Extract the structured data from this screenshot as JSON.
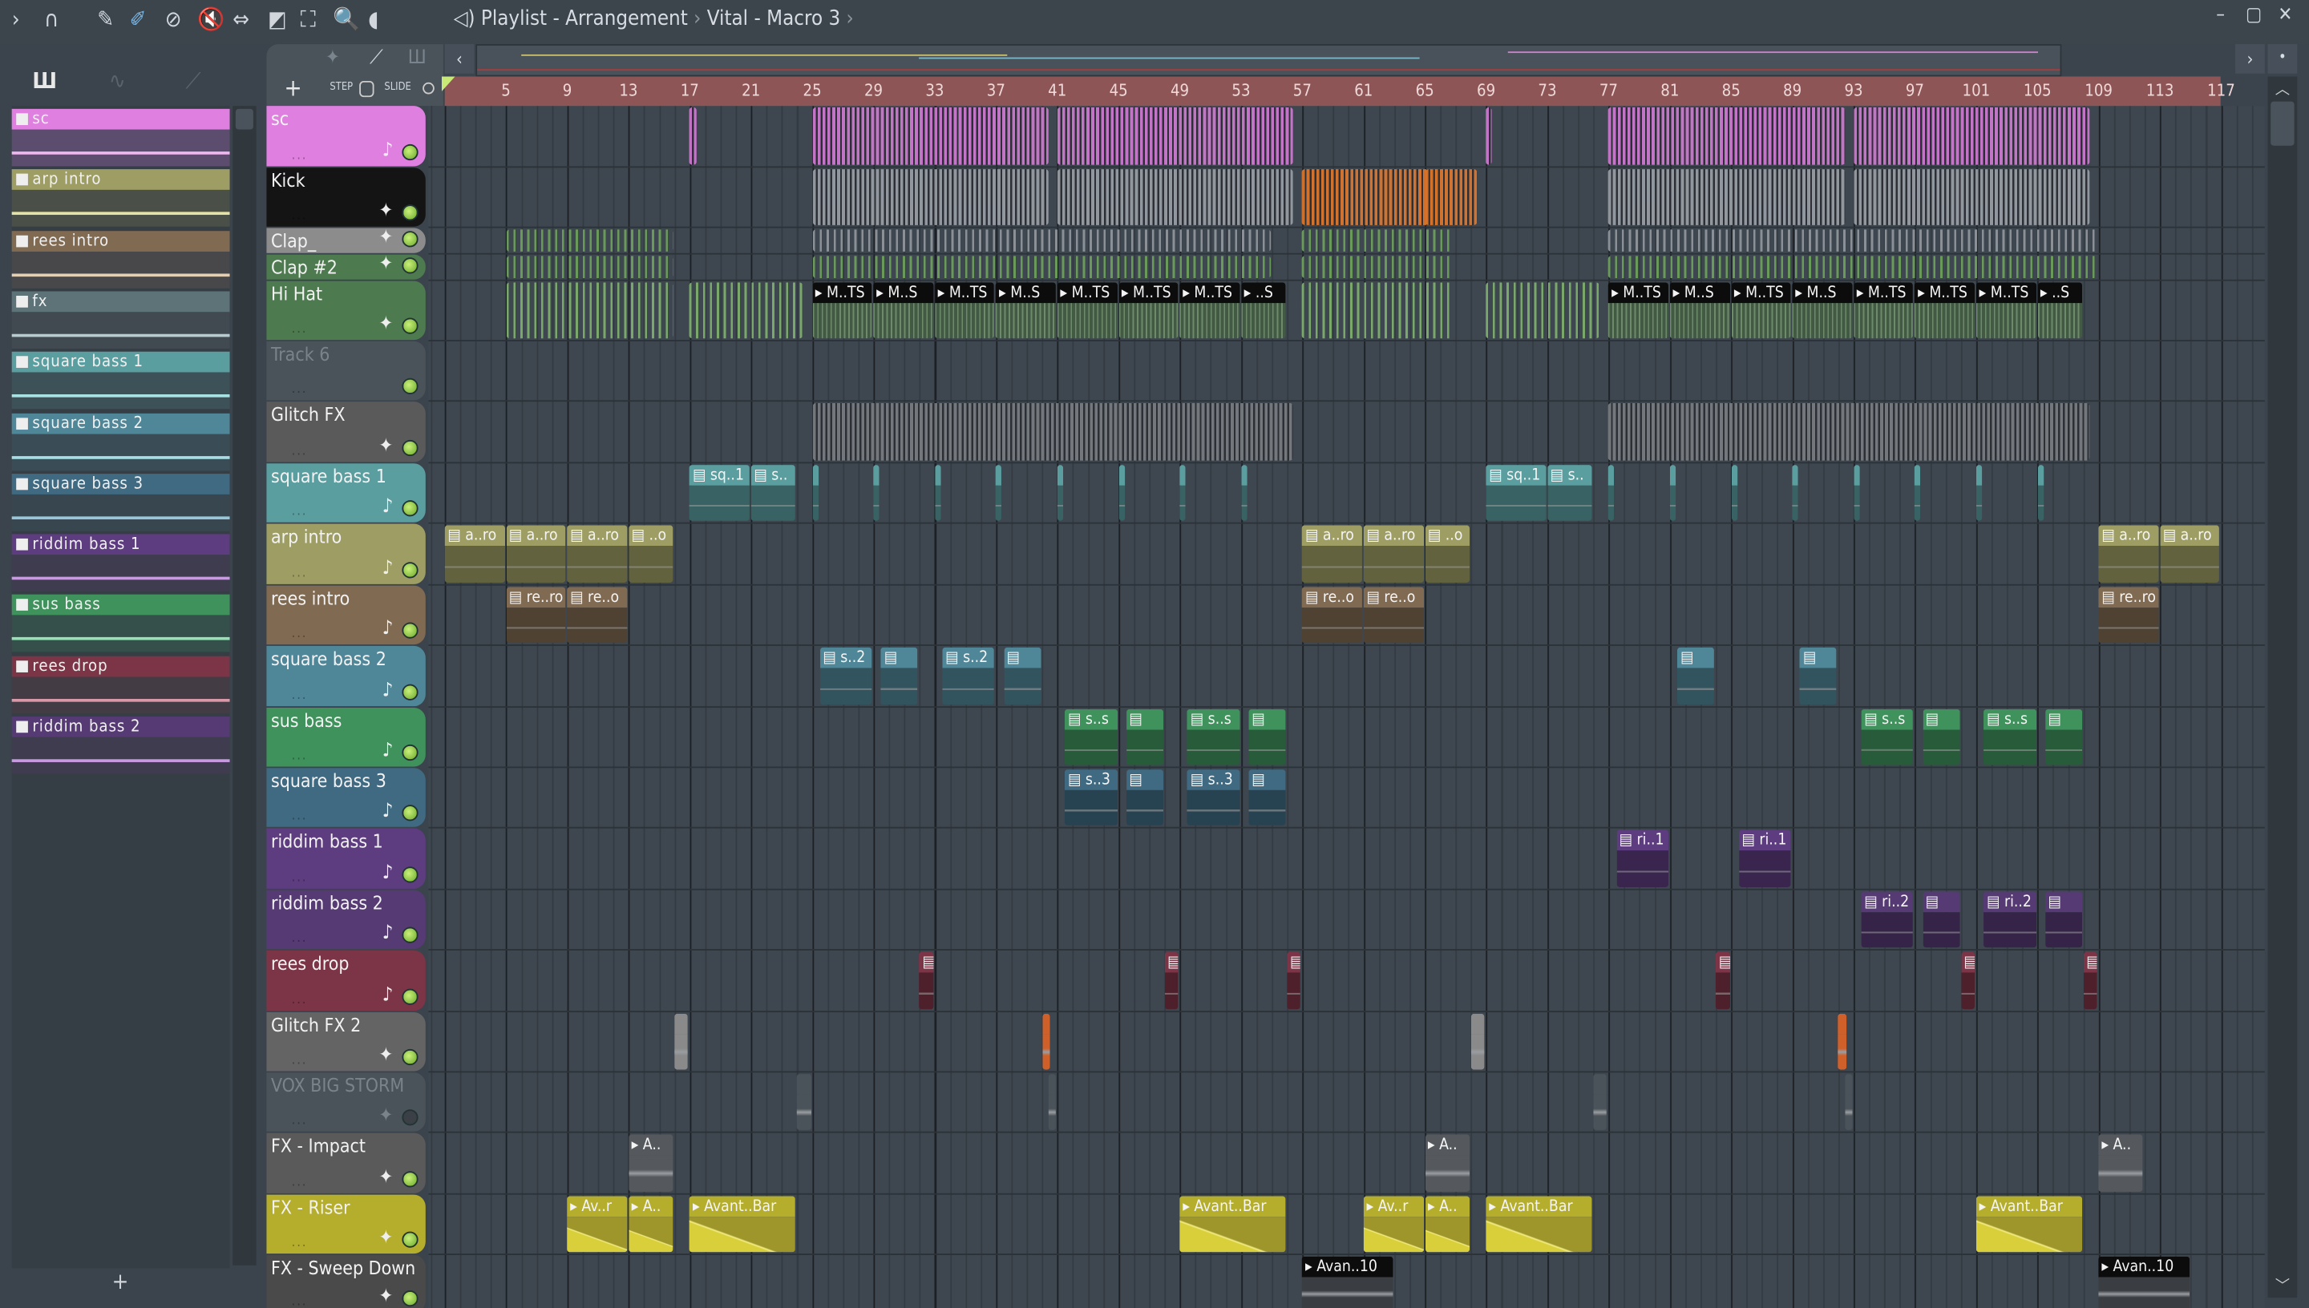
{
  "toolbar": {
    "icons": [
      "arrow-right-icon",
      "magnet-icon",
      "pencil-icon",
      "paint-icon",
      "delete-icon",
      "mute-icon",
      "slip-icon",
      "slice-icon",
      "select-icon",
      "zoom-icon",
      "playback-icon"
    ],
    "glyphs": [
      "›",
      "∩",
      "✎",
      "✐",
      "⊘",
      "🔇",
      "⇔",
      "◩",
      "⛶",
      "🔍",
      "◖"
    ]
  },
  "title": {
    "speaker": "◁)",
    "text": "Playlist - Arrangement",
    "sep": "›",
    "sub": "Vital - Macro 3",
    "sep2": "›"
  },
  "window": {
    "minimize": "–",
    "maximize": "▢",
    "close": "✕"
  },
  "picker": {
    "tabs": [
      "Ш",
      "∿",
      "⟋"
    ],
    "add": "+",
    "items": [
      {
        "label": "sc",
        "color": "#df7fe0",
        "body": "#5c4c6e",
        "line": "#f0b6f0"
      },
      {
        "label": "arp intro",
        "color": "#9e9e64",
        "body": "#4a5048",
        "line": "#e4e2a4"
      },
      {
        "label": "rees intro",
        "color": "#806a52",
        "body": "#48484a",
        "line": "#e2cfb4"
      },
      {
        "label": "fx",
        "color": "#5e7378",
        "body": "#404a50",
        "line": "#b7cbd0"
      },
      {
        "label": "square bass 1",
        "color": "#5a9ea0",
        "body": "#3d5258",
        "line": "#a8e2e2"
      },
      {
        "label": "square bass 2",
        "color": "#4f8799",
        "body": "#3a4c56",
        "line": "#a8dce6"
      },
      {
        "label": "square bass 3",
        "color": "#3f6a82",
        "body": "#38464f",
        "line": "#98c6d8"
      },
      {
        "label": "riddim bass 1",
        "color": "#5e3c80",
        "body": "#3e3c4e",
        "line": "#c89ae0"
      },
      {
        "label": "sus bass",
        "color": "#3f925c",
        "body": "#35504a",
        "line": "#98e0b6"
      },
      {
        "label": "rees drop",
        "color": "#7c3447",
        "body": "#443c44",
        "line": "#d899a8"
      },
      {
        "label": "riddim bass 2",
        "color": "#553a74",
        "body": "#3e3c4e",
        "line": "#c89ae0"
      }
    ]
  },
  "step": {
    "step_label": "STEP",
    "slide_label": "SLIDE",
    "add": "+"
  },
  "ruler": {
    "labels": [
      "5",
      "9",
      "13",
      "17",
      "21",
      "25",
      "29",
      "33",
      "37",
      "41",
      "45",
      "49",
      "53",
      "57",
      "61",
      "65",
      "69",
      "73",
      "77",
      "81",
      "85",
      "89",
      "93",
      "97",
      "101",
      "105",
      "109",
      "113",
      "117"
    ]
  },
  "tracks": [
    {
      "name": "sc",
      "color": "#df7fe0",
      "icon": "♪",
      "led": true
    },
    {
      "name": "Kick",
      "color": "#141414",
      "icon": "✦",
      "led": true
    },
    {
      "name": "Clap_",
      "color": "#8c8c8c",
      "icon": "✦",
      "led": true
    },
    {
      "name": "Clap  #2",
      "color": "#4d7a4e",
      "icon": "✦",
      "led": true
    },
    {
      "name": "Hi Hat",
      "color": "#4d7a4e",
      "icon": "✦",
      "led": true
    },
    {
      "name": "Track 6",
      "color": "#4b535a",
      "icon": "",
      "led": true,
      "dim": true
    },
    {
      "name": "Glitch FX",
      "color": "#5a5a5a",
      "icon": "✦",
      "led": true
    },
    {
      "name": "square bass 1",
      "color": "#5a9ea0",
      "icon": "♪",
      "led": true
    },
    {
      "name": "arp intro",
      "color": "#9e9e64",
      "icon": "♪",
      "led": true
    },
    {
      "name": "rees intro",
      "color": "#806a52",
      "icon": "♪",
      "led": true
    },
    {
      "name": "square bass 2",
      "color": "#4f8799",
      "icon": "♪",
      "led": true
    },
    {
      "name": "sus bass",
      "color": "#3f925c",
      "icon": "♪",
      "led": true
    },
    {
      "name": "square bass 3",
      "color": "#3f6a82",
      "icon": "♪",
      "led": true
    },
    {
      "name": "riddim bass 1",
      "color": "#5e3c80",
      "icon": "♪",
      "led": true
    },
    {
      "name": "riddim bass 2",
      "color": "#553a74",
      "icon": "♪",
      "led": true
    },
    {
      "name": "rees drop",
      "color": "#7c3447",
      "icon": "♪",
      "led": true
    },
    {
      "name": "Glitch FX 2",
      "color": "#646464",
      "icon": "✦",
      "led": true
    },
    {
      "name": "VOX BIG STORM",
      "color": "#4b535a",
      "icon": "✦",
      "led": false,
      "dim": true
    },
    {
      "name": "FX - Impact",
      "color": "#5a5a5a",
      "icon": "✦",
      "led": true
    },
    {
      "name": "FX - Riser",
      "color": "#b5ad2c",
      "icon": "✦",
      "led": true
    },
    {
      "name": "FX - Sweep Down",
      "color": "#4a4a4a",
      "icon": "✦",
      "led": true
    }
  ],
  "clips": [
    {
      "t": 0,
      "s": 17,
      "l": 0.5,
      "k": "dense",
      "c": "#d17ad3"
    },
    {
      "t": 0,
      "s": 25,
      "l": 15.5,
      "k": "dense",
      "c": "#d17ad3"
    },
    {
      "t": 0,
      "s": 41,
      "l": 15.5,
      "k": "dense",
      "c": "#d17ad3"
    },
    {
      "t": 0,
      "s": 69,
      "l": 0.5,
      "k": "dense",
      "c": "#d17ad3"
    },
    {
      "t": 0,
      "s": 77,
      "l": 15.5,
      "k": "dense",
      "c": "#d17ad3"
    },
    {
      "t": 0,
      "s": 93,
      "l": 15.5,
      "k": "dense",
      "c": "#d17ad3"
    },
    {
      "t": 1,
      "s": 25,
      "l": 15.5,
      "k": "dense",
      "c": "#9aa0a6"
    },
    {
      "t": 1,
      "s": 41,
      "l": 15.5,
      "k": "dense",
      "c": "#9aa0a6"
    },
    {
      "t": 1,
      "s": 57,
      "l": 9,
      "k": "dense",
      "c": "#e0782c"
    },
    {
      "t": 1,
      "s": 65,
      "l": 3.5,
      "k": "dense",
      "c": "#e0782c"
    },
    {
      "t": 1,
      "s": 77,
      "l": 15.5,
      "k": "dense",
      "c": "#9aa0a6"
    },
    {
      "t": 1,
      "s": 93,
      "l": 15.5,
      "k": "dense",
      "c": "#9aa0a6"
    },
    {
      "t": 2,
      "s": 5,
      "l": 11,
      "k": "ticks",
      "c": "#6a9a5a"
    },
    {
      "t": 2,
      "s": 25,
      "l": 30,
      "k": "ticks",
      "c": "#8a9096"
    },
    {
      "t": 2,
      "s": 57,
      "l": 10,
      "k": "ticks",
      "c": "#6a9a5a"
    },
    {
      "t": 2,
      "s": 77,
      "l": 32,
      "k": "ticks",
      "c": "#8a9096"
    },
    {
      "t": 3,
      "s": 5,
      "l": 11,
      "k": "ticks",
      "c": "#6a9a5a"
    },
    {
      "t": 3,
      "s": 25,
      "l": 30,
      "k": "ticks",
      "c": "#6a9a5a"
    },
    {
      "t": 3,
      "s": 57,
      "l": 10,
      "k": "ticks",
      "c": "#6a9a5a"
    },
    {
      "t": 3,
      "s": 77,
      "l": 32,
      "k": "ticks",
      "c": "#6a9a5a"
    },
    {
      "t": 4,
      "s": 5,
      "l": 11,
      "k": "ticks",
      "c": "#7aa86a"
    },
    {
      "t": 4,
      "s": 17,
      "l": 7.5,
      "k": "ticks",
      "c": "#7aa86a"
    },
    {
      "t": 4,
      "s": 25,
      "l": 4,
      "k": "audio",
      "label": "M..TS",
      "c": "#4d6a4e"
    },
    {
      "t": 4,
      "s": 29,
      "l": 4,
      "k": "audio",
      "label": "M..S",
      "c": "#4d6a4e"
    },
    {
      "t": 4,
      "s": 33,
      "l": 4,
      "k": "audio",
      "label": "M..TS",
      "c": "#4d6a4e"
    },
    {
      "t": 4,
      "s": 37,
      "l": 4,
      "k": "audio",
      "label": "M..S",
      "c": "#4d6a4e"
    },
    {
      "t": 4,
      "s": 41,
      "l": 4,
      "k": "audio",
      "label": "M..TS",
      "c": "#4d6a4e"
    },
    {
      "t": 4,
      "s": 45,
      "l": 4,
      "k": "audio",
      "label": "M..TS",
      "c": "#4d6a4e"
    },
    {
      "t": 4,
      "s": 49,
      "l": 4,
      "k": "audio",
      "label": "M..TS",
      "c": "#4d6a4e"
    },
    {
      "t": 4,
      "s": 53,
      "l": 3,
      "k": "audio",
      "label": "..S",
      "c": "#4d6a4e"
    },
    {
      "t": 4,
      "s": 57,
      "l": 10,
      "k": "ticks",
      "c": "#7aa86a"
    },
    {
      "t": 4,
      "s": 69,
      "l": 7.5,
      "k": "ticks",
      "c": "#7aa86a"
    },
    {
      "t": 4,
      "s": 77,
      "l": 4,
      "k": "audio",
      "label": "M..TS",
      "c": "#4d6a4e"
    },
    {
      "t": 4,
      "s": 81,
      "l": 4,
      "k": "audio",
      "label": "M..S",
      "c": "#4d6a4e"
    },
    {
      "t": 4,
      "s": 85,
      "l": 4,
      "k": "audio",
      "label": "M..TS",
      "c": "#4d6a4e"
    },
    {
      "t": 4,
      "s": 89,
      "l": 4,
      "k": "audio",
      "label": "M..S",
      "c": "#4d6a4e"
    },
    {
      "t": 4,
      "s": 93,
      "l": 4,
      "k": "audio",
      "label": "M..TS",
      "c": "#4d6a4e"
    },
    {
      "t": 4,
      "s": 97,
      "l": 4,
      "k": "audio",
      "label": "M..TS",
      "c": "#4d6a4e"
    },
    {
      "t": 4,
      "s": 101,
      "l": 4,
      "k": "audio",
      "label": "M..TS",
      "c": "#4d6a4e"
    },
    {
      "t": 4,
      "s": 105,
      "l": 3,
      "k": "audio",
      "label": "..S",
      "c": "#4d6a4e"
    },
    {
      "t": 6,
      "s": 25,
      "l": 31.5,
      "k": "dense",
      "c": "#7a7e82"
    },
    {
      "t": 6,
      "s": 77,
      "l": 31.5,
      "k": "dense",
      "c": "#7a7e82"
    },
    {
      "t": 7,
      "s": 17,
      "l": 4,
      "k": "pattern",
      "label": "sq..1",
      "c": "#5a9ea0"
    },
    {
      "t": 7,
      "s": 21,
      "l": 3,
      "k": "pattern",
      "label": "s..",
      "c": "#5a9ea0"
    },
    {
      "t": 7,
      "s": 25,
      "l": 0.4,
      "k": "pattern",
      "c": "#5a9ea0"
    },
    {
      "t": 7,
      "s": 29,
      "l": 0.4,
      "k": "pattern",
      "c": "#5a9ea0"
    },
    {
      "t": 7,
      "s": 33,
      "l": 0.4,
      "k": "pattern",
      "c": "#5a9ea0"
    },
    {
      "t": 7,
      "s": 37,
      "l": 0.4,
      "k": "pattern",
      "c": "#5a9ea0"
    },
    {
      "t": 7,
      "s": 41,
      "l": 0.4,
      "k": "pattern",
      "c": "#5a9ea0"
    },
    {
      "t": 7,
      "s": 45,
      "l": 0.4,
      "k": "pattern",
      "c": "#5a9ea0"
    },
    {
      "t": 7,
      "s": 49,
      "l": 0.4,
      "k": "pattern",
      "c": "#5a9ea0"
    },
    {
      "t": 7,
      "s": 53,
      "l": 0.4,
      "k": "pattern",
      "c": "#5a9ea0"
    },
    {
      "t": 7,
      "s": 69,
      "l": 4,
      "k": "pattern",
      "label": "sq..1",
      "c": "#5a9ea0"
    },
    {
      "t": 7,
      "s": 73,
      "l": 3,
      "k": "pattern",
      "label": "s..",
      "c": "#5a9ea0"
    },
    {
      "t": 7,
      "s": 77,
      "l": 0.4,
      "k": "pattern",
      "c": "#5a9ea0"
    },
    {
      "t": 7,
      "s": 81,
      "l": 0.4,
      "k": "pattern",
      "c": "#5a9ea0"
    },
    {
      "t": 7,
      "s": 85,
      "l": 0.4,
      "k": "pattern",
      "c": "#5a9ea0"
    },
    {
      "t": 7,
      "s": 89,
      "l": 0.4,
      "k": "pattern",
      "c": "#5a9ea0"
    },
    {
      "t": 7,
      "s": 93,
      "l": 0.4,
      "k": "pattern",
      "c": "#5a9ea0"
    },
    {
      "t": 7,
      "s": 97,
      "l": 0.4,
      "k": "pattern",
      "c": "#5a9ea0"
    },
    {
      "t": 7,
      "s": 101,
      "l": 0.4,
      "k": "pattern",
      "c": "#5a9ea0"
    },
    {
      "t": 7,
      "s": 105,
      "l": 0.4,
      "k": "pattern",
      "c": "#5a9ea0"
    },
    {
      "t": 8,
      "s": 1,
      "l": 4,
      "k": "pattern",
      "label": "a..ro",
      "c": "#9e9e64"
    },
    {
      "t": 8,
      "s": 5,
      "l": 4,
      "k": "pattern",
      "label": "a..ro",
      "c": "#9e9e64"
    },
    {
      "t": 8,
      "s": 9,
      "l": 4,
      "k": "pattern",
      "label": "a..ro",
      "c": "#9e9e64"
    },
    {
      "t": 8,
      "s": 13,
      "l": 3,
      "k": "pattern",
      "label": "..o",
      "c": "#9e9e64"
    },
    {
      "t": 8,
      "s": 57,
      "l": 4,
      "k": "pattern",
      "label": "a..ro",
      "c": "#9e9e64"
    },
    {
      "t": 8,
      "s": 61,
      "l": 4,
      "k": "pattern",
      "label": "a..ro",
      "c": "#9e9e64"
    },
    {
      "t": 8,
      "s": 65,
      "l": 3,
      "k": "pattern",
      "label": "..o",
      "c": "#9e9e64"
    },
    {
      "t": 8,
      "s": 109,
      "l": 4,
      "k": "pattern",
      "label": "a..ro",
      "c": "#9e9e64"
    },
    {
      "t": 8,
      "s": 113,
      "l": 4,
      "k": "pattern",
      "label": "a..ro",
      "c": "#9e9e64"
    },
    {
      "t": 9,
      "s": 5,
      "l": 4,
      "k": "pattern",
      "label": "re..ro",
      "c": "#806a52"
    },
    {
      "t": 9,
      "s": 9,
      "l": 4,
      "k": "pattern",
      "label": "re..o",
      "c": "#806a52"
    },
    {
      "t": 9,
      "s": 57,
      "l": 4,
      "k": "pattern",
      "label": "re..o",
      "c": "#806a52"
    },
    {
      "t": 9,
      "s": 61,
      "l": 4,
      "k": "pattern",
      "label": "re..o",
      "c": "#806a52"
    },
    {
      "t": 9,
      "s": 109,
      "l": 4,
      "k": "pattern",
      "label": "re..ro",
      "c": "#806a52"
    },
    {
      "t": 10,
      "s": 25.5,
      "l": 3.5,
      "k": "pattern",
      "label": "s..2",
      "c": "#4f8799"
    },
    {
      "t": 10,
      "s": 29.5,
      "l": 2.5,
      "k": "pattern",
      "label": "",
      "c": "#4f8799"
    },
    {
      "t": 10,
      "s": 33.5,
      "l": 3.5,
      "k": "pattern",
      "label": "s..2",
      "c": "#4f8799"
    },
    {
      "t": 10,
      "s": 37.5,
      "l": 2.5,
      "k": "pattern",
      "label": "",
      "c": "#4f8799"
    },
    {
      "t": 10,
      "s": 81.5,
      "l": 2.5,
      "k": "pattern",
      "label": "",
      "c": "#4f8799"
    },
    {
      "t": 10,
      "s": 89.5,
      "l": 2.5,
      "k": "pattern",
      "label": "",
      "c": "#4f8799"
    },
    {
      "t": 11,
      "s": 41.5,
      "l": 3.5,
      "k": "pattern",
      "label": "s..s",
      "c": "#3f925c"
    },
    {
      "t": 11,
      "s": 45.5,
      "l": 2.5,
      "k": "pattern",
      "label": "",
      "c": "#3f925c"
    },
    {
      "t": 11,
      "s": 49.5,
      "l": 3.5,
      "k": "pattern",
      "label": "s..s",
      "c": "#3f925c"
    },
    {
      "t": 11,
      "s": 53.5,
      "l": 2.5,
      "k": "pattern",
      "label": "",
      "c": "#3f925c"
    },
    {
      "t": 11,
      "s": 93.5,
      "l": 3.5,
      "k": "pattern",
      "label": "s..s",
      "c": "#3f925c"
    },
    {
      "t": 11,
      "s": 97.5,
      "l": 2.5,
      "k": "pattern",
      "label": "",
      "c": "#3f925c"
    },
    {
      "t": 11,
      "s": 101.5,
      "l": 3.5,
      "k": "pattern",
      "label": "s..s",
      "c": "#3f925c"
    },
    {
      "t": 11,
      "s": 105.5,
      "l": 2.5,
      "k": "pattern",
      "label": "",
      "c": "#3f925c"
    },
    {
      "t": 12,
      "s": 41.5,
      "l": 3.5,
      "k": "pattern",
      "label": "s..3",
      "c": "#3f6a82"
    },
    {
      "t": 12,
      "s": 45.5,
      "l": 2.5,
      "k": "pattern",
      "label": "",
      "c": "#3f6a82"
    },
    {
      "t": 12,
      "s": 49.5,
      "l": 3.5,
      "k": "pattern",
      "label": "s..3",
      "c": "#3f6a82"
    },
    {
      "t": 12,
      "s": 53.5,
      "l": 2.5,
      "k": "pattern",
      "label": "",
      "c": "#3f6a82"
    },
    {
      "t": 13,
      "s": 77.5,
      "l": 3.5,
      "k": "pattern",
      "label": "ri..1",
      "c": "#5e3c80"
    },
    {
      "t": 13,
      "s": 85.5,
      "l": 3.5,
      "k": "pattern",
      "label": "ri..1",
      "c": "#5e3c80"
    },
    {
      "t": 14,
      "s": 93.5,
      "l": 3.5,
      "k": "pattern",
      "label": "ri..2",
      "c": "#553a74"
    },
    {
      "t": 14,
      "s": 97.5,
      "l": 2.5,
      "k": "pattern",
      "label": "",
      "c": "#553a74"
    },
    {
      "t": 14,
      "s": 101.5,
      "l": 3.5,
      "k": "pattern",
      "label": "ri..2",
      "c": "#553a74"
    },
    {
      "t": 14,
      "s": 105.5,
      "l": 2.5,
      "k": "pattern",
      "label": "",
      "c": "#553a74"
    },
    {
      "t": 15,
      "s": 32,
      "l": 1,
      "k": "pattern",
      "c": "#7c3447"
    },
    {
      "t": 15,
      "s": 48,
      "l": 1,
      "k": "pattern",
      "c": "#7c3447"
    },
    {
      "t": 15,
      "s": 56,
      "l": 1,
      "k": "pattern",
      "c": "#7c3447"
    },
    {
      "t": 15,
      "s": 84,
      "l": 1,
      "k": "pattern",
      "c": "#7c3447"
    },
    {
      "t": 15,
      "s": 100,
      "l": 1,
      "k": "pattern",
      "c": "#7c3447"
    },
    {
      "t": 15,
      "s": 108,
      "l": 1,
      "k": "pattern",
      "c": "#7c3447"
    },
    {
      "t": 16,
      "s": 16,
      "l": 1,
      "k": "audio",
      "c": "#8a8a8a"
    },
    {
      "t": 16,
      "s": 40,
      "l": 0.6,
      "k": "audio",
      "c": "#d0602a"
    },
    {
      "t": 16,
      "s": 68,
      "l": 1,
      "k": "audio",
      "c": "#8a8a8a"
    },
    {
      "t": 16,
      "s": 92,
      "l": 0.6,
      "k": "audio",
      "c": "#d0602a"
    },
    {
      "t": 17,
      "s": 24,
      "l": 1,
      "k": "audio",
      "c": "#4b535a"
    },
    {
      "t": 17,
      "s": 40.4,
      "l": 0.6,
      "k": "audio",
      "c": "#4b535a"
    },
    {
      "t": 17,
      "s": 76,
      "l": 1,
      "k": "audio",
      "c": "#4b535a"
    },
    {
      "t": 17,
      "s": 92.4,
      "l": 0.6,
      "k": "audio",
      "c": "#4b535a"
    },
    {
      "t": 18,
      "s": 13,
      "l": 3,
      "k": "audio",
      "label": "A..",
      "c": "#55595d"
    },
    {
      "t": 18,
      "s": 65,
      "l": 3,
      "k": "audio",
      "label": "A..",
      "c": "#55595d"
    },
    {
      "t": 18,
      "s": 109,
      "l": 3,
      "k": "audio",
      "label": "A..",
      "c": "#55595d"
    },
    {
      "t": 19,
      "s": 9,
      "l": 4,
      "k": "audio",
      "label": "Av..r",
      "c": "#b5ad2c"
    },
    {
      "t": 19,
      "s": 13,
      "l": 3,
      "k": "audio",
      "label": "A..",
      "c": "#b5ad2c"
    },
    {
      "t": 19,
      "s": 17,
      "l": 7,
      "k": "audio",
      "label": "Avant..Bar",
      "c": "#b5ad2c"
    },
    {
      "t": 19,
      "s": 49,
      "l": 7,
      "k": "audio",
      "label": "Avant..Bar",
      "c": "#b5ad2c"
    },
    {
      "t": 19,
      "s": 61,
      "l": 4,
      "k": "audio",
      "label": "Av..r",
      "c": "#b5ad2c"
    },
    {
      "t": 19,
      "s": 65,
      "l": 3,
      "k": "audio",
      "label": "A..",
      "c": "#b5ad2c"
    },
    {
      "t": 19,
      "s": 69,
      "l": 7,
      "k": "audio",
      "label": "Avant..Bar",
      "c": "#b5ad2c"
    },
    {
      "t": 19,
      "s": 101,
      "l": 7,
      "k": "audio",
      "label": "Avant..Bar",
      "c": "#b5ad2c"
    },
    {
      "t": 20,
      "s": 57,
      "l": 6,
      "k": "audio",
      "label": "Avan..10",
      "c": "#3a3e42"
    },
    {
      "t": 20,
      "s": 109,
      "l": 6,
      "k": "audio",
      "label": "Avan..10",
      "c": "#3a3e42"
    }
  ]
}
